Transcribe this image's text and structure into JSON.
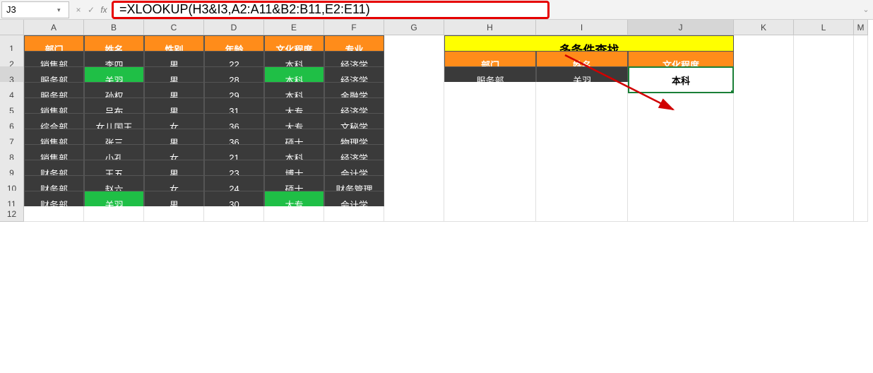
{
  "namebox": {
    "value": "J3"
  },
  "formula_bar": {
    "value": "=XLOOKUP(H3&I3,A2:A11&B2:B11,E2:E11)"
  },
  "icons": {
    "fx": "fx",
    "cancel": "×",
    "accept": "✓",
    "dropdown": "▾",
    "expand": "⌄"
  },
  "col_headers": [
    "A",
    "B",
    "C",
    "D",
    "E",
    "F",
    "G",
    "H",
    "I",
    "J",
    "K",
    "L",
    "M"
  ],
  "row_headers": [
    "1",
    "2",
    "3",
    "4",
    "5",
    "6",
    "7",
    "8",
    "9",
    "10",
    "11",
    "12"
  ],
  "main_table": {
    "headers": [
      "部门",
      "姓名",
      "性别",
      "年龄",
      "文化程度",
      "专业"
    ],
    "rows": [
      [
        "销售部",
        "李四",
        "男",
        "22",
        "本科",
        "经济学"
      ],
      [
        "服务部",
        "关羽",
        "男",
        "28",
        "本科",
        "经济学"
      ],
      [
        "服务部",
        "孙权",
        "男",
        "29",
        "本科",
        "金融学"
      ],
      [
        "销售部",
        "吕布",
        "男",
        "31",
        "大专",
        "经济学"
      ],
      [
        "综合部",
        "女儿国王",
        "女",
        "36",
        "大专",
        "文秘学"
      ],
      [
        "销售部",
        "张三",
        "男",
        "36",
        "硕士",
        "物理学"
      ],
      [
        "销售部",
        "小孔",
        "女",
        "21",
        "本科",
        "经济学"
      ],
      [
        "财务部",
        "王五",
        "男",
        "23",
        "博士",
        "会计学"
      ],
      [
        "财务部",
        "赵六",
        "女",
        "24",
        "硕士",
        "财务管理"
      ],
      [
        "财务部",
        "关羽",
        "男",
        "30",
        "大专",
        "会计学"
      ]
    ],
    "highlight_row_indices_name_edu": [
      1,
      9
    ]
  },
  "lookup_panel": {
    "title": "多条件查找",
    "headers": [
      "部门",
      "姓名",
      "文化程度"
    ],
    "row": [
      "服务部",
      "关羽",
      "本科"
    ]
  },
  "active_cell": "J3"
}
